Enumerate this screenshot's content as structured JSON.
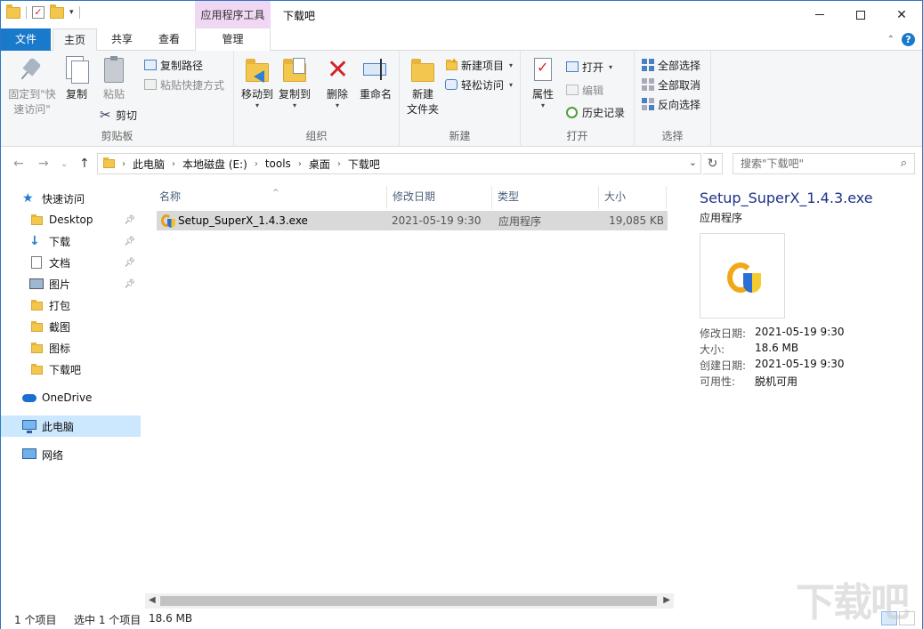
{
  "window": {
    "title": "下载吧",
    "contextual_tab_header": "应用程序工具"
  },
  "tabs": {
    "file": "文件",
    "home": "主页",
    "share": "共享",
    "view": "查看",
    "manage": "管理"
  },
  "ribbon": {
    "clipboard": {
      "label": "剪贴板",
      "pin_quick_access_line1": "固定到\"快",
      "pin_quick_access_line2": "速访问\"",
      "copy": "复制",
      "paste": "粘贴",
      "copy_path": "复制路径",
      "paste_shortcut": "粘贴快捷方式",
      "cut": "剪切"
    },
    "organize": {
      "label": "组织",
      "move_to": "移动到",
      "copy_to": "复制到",
      "delete": "删除",
      "rename": "重命名"
    },
    "new": {
      "label": "新建",
      "new_folder_line1": "新建",
      "new_folder_line2": "文件夹",
      "new_item": "新建项目",
      "easy_access": "轻松访问"
    },
    "open": {
      "label": "打开",
      "properties": "属性",
      "open": "打开",
      "edit": "编辑",
      "history": "历史记录"
    },
    "select": {
      "label": "选择",
      "select_all": "全部选择",
      "select_none": "全部取消",
      "invert": "反向选择"
    }
  },
  "address": {
    "crumbs": [
      "此电脑",
      "本地磁盘 (E:)",
      "tools",
      "桌面",
      "下载吧"
    ],
    "search_placeholder": "搜索\"下载吧\""
  },
  "nav": {
    "quick_access": "快速访问",
    "items": [
      {
        "label": "Desktop",
        "pinned": true
      },
      {
        "label": "下载",
        "pinned": true
      },
      {
        "label": "文档",
        "pinned": true
      },
      {
        "label": "图片",
        "pinned": true
      },
      {
        "label": "打包",
        "pinned": false
      },
      {
        "label": "截图",
        "pinned": false
      },
      {
        "label": "图标",
        "pinned": false
      },
      {
        "label": "下载吧",
        "pinned": false
      }
    ],
    "onedrive": "OneDrive",
    "this_pc": "此电脑",
    "network": "网络"
  },
  "filelist": {
    "columns": [
      "名称",
      "修改日期",
      "类型",
      "大小"
    ],
    "rows": [
      {
        "name": "Setup_SuperX_1.4.3.exe",
        "date": "2021-05-19 9:30",
        "type": "应用程序",
        "size": "19,085 KB"
      }
    ]
  },
  "preview": {
    "filename": "Setup_SuperX_1.4.3.exe",
    "type": "应用程序",
    "props": [
      {
        "key": "修改日期:",
        "value": "2021-05-19 9:30"
      },
      {
        "key": "大小:",
        "value": "18.6 MB"
      },
      {
        "key": "创建日期:",
        "value": "2021-05-19 9:30"
      },
      {
        "key": "可用性:",
        "value": "脱机可用"
      }
    ]
  },
  "status": {
    "item_count": "1 个项目",
    "selected": "选中 1 个项目",
    "selected_size": "18.6 MB"
  },
  "watermark": "下载吧",
  "colors": {
    "accent": "#1979ca",
    "selection": "#cce8ff",
    "contextual_tab": "#f0d7f3"
  }
}
